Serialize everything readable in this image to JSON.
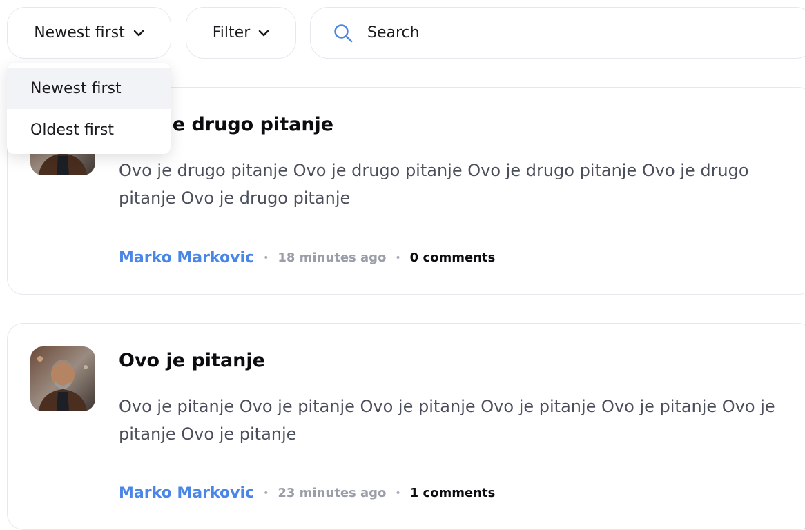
{
  "toolbar": {
    "sort_label": "Newest first",
    "filter_label": "Filter",
    "search_placeholder": "Search"
  },
  "sort_menu": {
    "options": [
      "Newest first",
      "Oldest first"
    ],
    "selected": "Newest first"
  },
  "questions": [
    {
      "title": "Ovo je drugo pitanje",
      "body": "Ovo je drugo pitanje Ovo je drugo pitanje Ovo je drugo pitanje Ovo je drugo pitanje Ovo je drugo pitanje",
      "author": "Marko Markovic",
      "time": "18 minutes ago",
      "comments": "0 comments"
    },
    {
      "title": "Ovo je pitanje",
      "body": "Ovo je pitanje Ovo je pitanje Ovo je pitanje Ovo je pitanje Ovo je pitanje Ovo je pitanje Ovo je pitanje",
      "author": "Marko Markovic",
      "time": "23 minutes ago",
      "comments": "1 comments"
    }
  ],
  "icons": {
    "chevron": "chevron-down-icon",
    "search": "search-icon",
    "avatar": "avatar"
  },
  "colors": {
    "accent": "#4a86e8",
    "border": "#e6e8ee",
    "menu_active_bg": "#f2f3f6"
  }
}
